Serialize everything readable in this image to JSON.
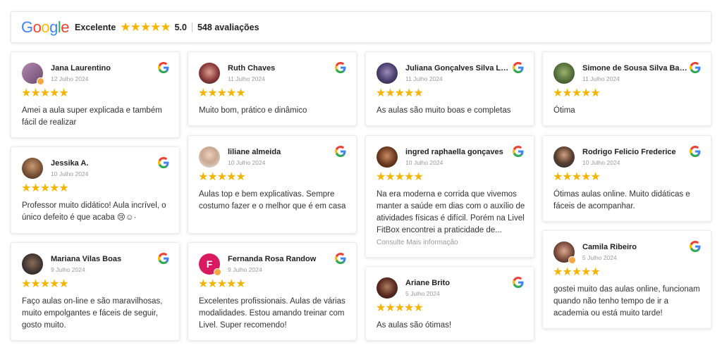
{
  "summary": {
    "brand": "Google",
    "rating_label": "Excelente",
    "stars": "★★★★★",
    "score": "5.0",
    "count": "548 avaliações"
  },
  "colors": {
    "star": "#f4b400",
    "google_blue": "#4285F4",
    "google_red": "#EA4335",
    "google_yellow": "#FBBC05",
    "google_green": "#34A853"
  },
  "reviews": [
    {
      "name": "Jana Laurentino",
      "date": "12 Julho 2024",
      "stars": "★★★★★",
      "text": "Amei a aula super explicada e também fácil de realizar"
    },
    {
      "name": "Jessika A.",
      "date": "10 Julho 2024",
      "stars": "★★★★★",
      "text": "Professor muito didático! Aula incrível, o único defeito é que acaba 😢☺·"
    },
    {
      "name": "Mariana Vilas Boas",
      "date": "9 Julho 2024",
      "stars": "★★★★★",
      "text": "Faço aulas on-line e são maravilhosas, muito empolgantes e fáceis de seguir, gosto muito."
    },
    {
      "name": "Ruth Chaves",
      "date": "11 Julho 2024",
      "stars": "★★★★★",
      "text": "Muito bom, prático e dinâmico"
    },
    {
      "name": "liliane almeida",
      "date": "10 Julho 2024",
      "stars": "★★★★★",
      "text": "Aulas top e bem explicativas. Sempre costumo fazer e o melhor que é em casa"
    },
    {
      "name": "Fernanda Rosa Randow",
      "date": "9 Julho 2024",
      "stars": "★★★★★",
      "initial": "F",
      "text": "Excelentes profissionais. Aulas de várias modalidades. Estou amando treinar com Livel. Super recomendo!"
    },
    {
      "name": "Juliana Gonçalves Silva Lo...",
      "date": "11 Julho 2024",
      "stars": "★★★★★",
      "text": "As aulas são muito boas e completas"
    },
    {
      "name": "ingred raphaella gonçaves",
      "date": "10 Julho 2024",
      "stars": "★★★★★",
      "text": "Na era moderna e corrida que vivemos manter a saúde em dias com o auxílio de atividades físicas é difícil. Porém na Livel FitBox encontrei a praticidade de...",
      "more": "Consulte Mais informação"
    },
    {
      "name": "Ariane Brito",
      "date": "5 Julho 2024",
      "stars": "★★★★★",
      "text": "As aulas são ótimas!"
    },
    {
      "name": "Simone de Sousa Silva Bar...",
      "date": "11 Julho 2024",
      "stars": "★★★★★",
      "text": "Ótima"
    },
    {
      "name": "Rodrigo Felicio Frederice",
      "date": "10 Julho 2024",
      "stars": "★★★★★",
      "text": "Ótimas aulas online. Muito didáticas e fáceis de acompanhar."
    },
    {
      "name": "Camila Ribeiro",
      "date": "5 Julho 2024",
      "stars": "★★★★★",
      "text": "gostei muito das aulas online, funcionam quando não tenho tempo de ir a academia ou está muito tarde!"
    }
  ]
}
